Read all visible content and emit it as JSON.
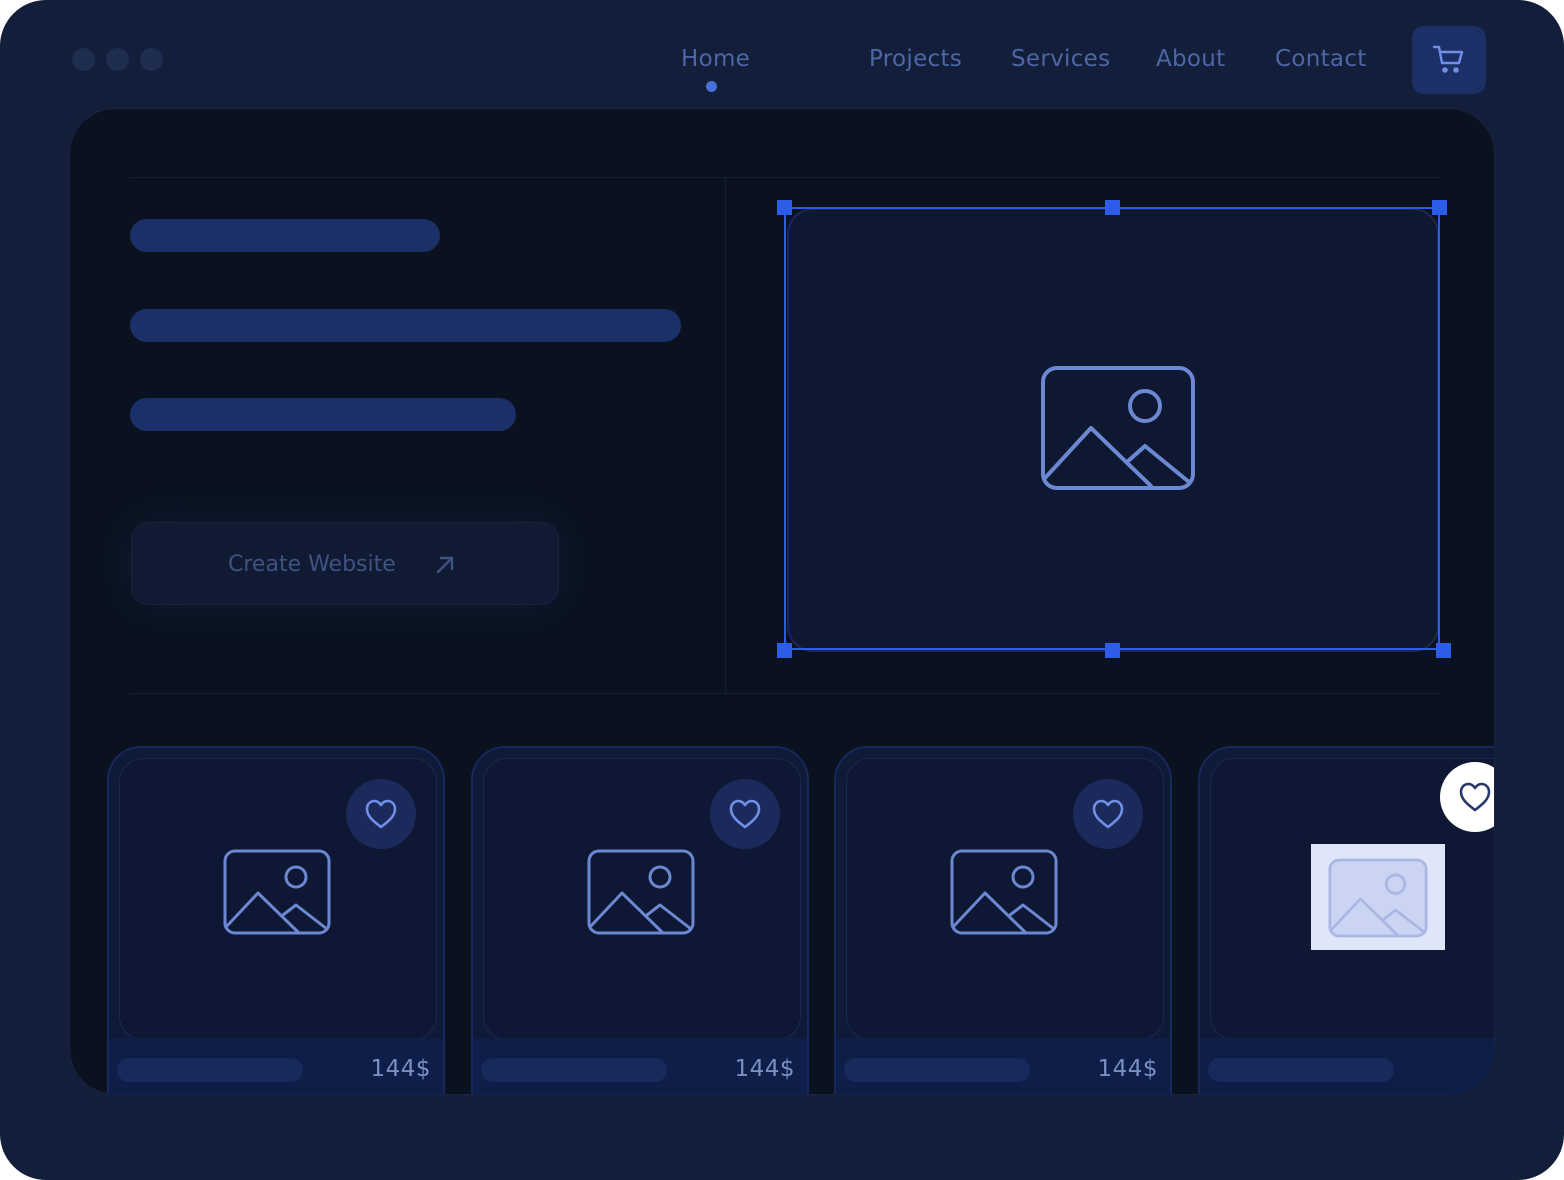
{
  "window": {
    "controls": [
      "close-dot",
      "minimize-dot",
      "maximize-dot"
    ]
  },
  "nav": {
    "items": [
      {
        "label": "Home",
        "active": true
      },
      {
        "label": "Projects"
      },
      {
        "label": "Services"
      },
      {
        "label": "About"
      },
      {
        "label": "Contact"
      }
    ],
    "cart_icon": "shopping-cart-icon"
  },
  "hero": {
    "cta_label": "Create Website",
    "cta_icon": "arrow-up-right-icon",
    "image_icon": "image-icon",
    "selected": true
  },
  "products": [
    {
      "price": "144$",
      "favorite_icon": "heart-icon"
    },
    {
      "price": "144$",
      "favorite_icon": "heart-icon"
    },
    {
      "price": "144$",
      "favorite_icon": "heart-icon"
    },
    {
      "price": "",
      "favorite_icon": "heart-icon"
    }
  ],
  "colors": {
    "accent": "#2d5ce8",
    "background": "#121e3a",
    "panel": "#0a1220"
  }
}
